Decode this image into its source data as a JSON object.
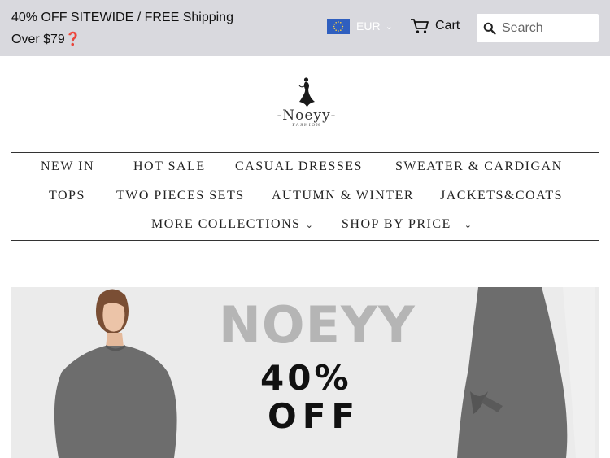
{
  "announcement": "40% OFF SITEWIDE / FREE Shipping Over $79❓",
  "currency": {
    "flag_icon": "eu-flag-icon",
    "label": "EUR",
    "chevron_icon": "chevron-down-icon"
  },
  "cart": {
    "icon": "cart-icon",
    "label": "Cart"
  },
  "search": {
    "icon": "search-icon",
    "placeholder": "Search"
  },
  "logo": {
    "name": "-Noeyy-",
    "tagline": "FASHION"
  },
  "nav": {
    "new_in": "NEW IN",
    "hot_sale": "HOT SALE",
    "casual_dresses": "CASUAL DRESSES",
    "sweater_cardigan": "SWEATER & CARDIGAN",
    "tops": "TOPS",
    "two_pieces_sets": "TWO PIECES SETS",
    "autumn_winter": "AUTUMN & WINTER",
    "jackets_coats": "JACKETS&COATS",
    "more_collections": "MORE COLLECTIONS",
    "shop_by_price": "SHOP BY PRICE"
  },
  "banner": {
    "brand": "NOEYY",
    "discount": "40%",
    "off": "OFF"
  },
  "colors": {
    "topbar_bg": "#d9d9de",
    "flag_blue": "#2f5fbf",
    "banner_bg": "#ebebeb",
    "brand_grey": "#b5b5b5",
    "sweater_grey": "#6d6d6d"
  }
}
